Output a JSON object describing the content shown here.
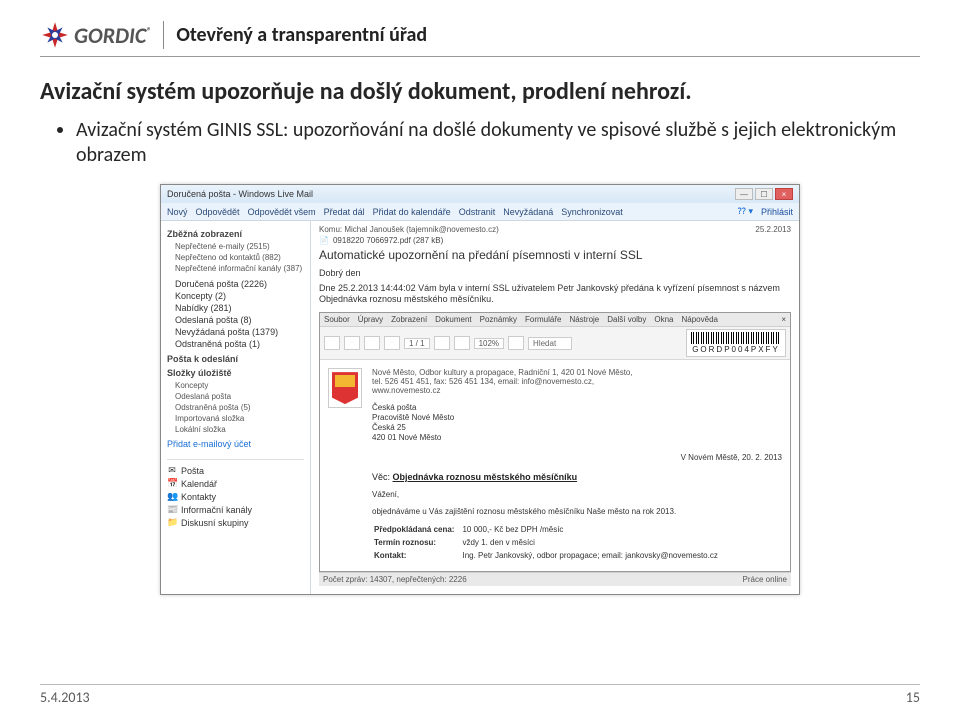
{
  "branding": {
    "name": "GORDIC",
    "reg": "®"
  },
  "presentation_title": "Otevřený a transparentní úřad",
  "headline": "Avizační systém upozorňuje na došlý dokument, prodlení nehrozí.",
  "bullet": "Avizační systém GINIS SSL: upozorňování na došlé dokumenty ve spisové službě s jejich elektronickým obrazem",
  "wlm": {
    "title": "Doručená pošta - Windows Live Mail",
    "toolbar": {
      "novy": "Nový",
      "odpovedet": "Odpovědět",
      "odpovedet_vsem": "Odpovědět všem",
      "predat": "Předat dál",
      "kalendar": "Přidat do kalendáře",
      "odstranit": "Odstranit",
      "nevyzadana": "Nevyžádaná",
      "sync": "Synchronizovat",
      "prihlasit": "Přihlásit"
    },
    "sidebar": {
      "rychle_hdr": "Zběžná zobrazení",
      "rychle": [
        "Nepřečtené e-maily  (2515)",
        "Nepřečteno od kontaktů  (882)",
        "Nepřečtené informační kanály  (387)"
      ],
      "folders": [
        "Doručená pošta  (2226)",
        "Koncepty  (2)",
        "Nabídky  (281)",
        "Odeslaná pošta  (8)",
        "Nevyžádaná pošta  (1379)",
        "Odstraněná pošta  (1)"
      ],
      "odeslani_hdr": "Pošta k odeslání",
      "uloziste_hdr": "Složky úložiště",
      "uloziste": [
        "Koncepty",
        "Odeslaná pošta",
        "Odstraněná pošta  (5)",
        "Importovaná složka",
        "Lokální složka"
      ],
      "add_link": "Přidat e-mailový účet",
      "bottom": [
        {
          "icon": "✉",
          "label": "Pošta"
        },
        {
          "icon": "📅",
          "label": "Kalendář"
        },
        {
          "icon": "👥",
          "label": "Kontakty"
        },
        {
          "icon": "📰",
          "label": "Informační kanály"
        },
        {
          "icon": "📁",
          "label": "Diskusní skupiny"
        }
      ]
    },
    "mail": {
      "from_label": "Komu:",
      "from": "Michal Janoušek (tajemnik@novemesto.cz)",
      "date": "25.2.2013",
      "attachment": "0918220 7066972.pdf (287 kB)",
      "subject": "Automatické upozornění na předání písemnosti v interní SSL",
      "greeting": "Dobrý den",
      "body_line": "Dne 25.2.2013 14:44:02 Vám byla v interní SSL uživatelem Petr Jankovský předána k vyřízení písemnost s názvem Objednávka roznosu městského měsíčníku."
    }
  },
  "inner": {
    "menu": [
      "Soubor",
      "Úpravy",
      "Zobrazení",
      "Dokument",
      "Poznámky",
      "Formuláře",
      "Nástroje",
      "Další volby",
      "Okna",
      "Nápověda"
    ],
    "zoom": "102%",
    "hledat_placeholder": "Hledat",
    "page_field": "1 / 1",
    "barcode": "GORDP004PXFY",
    "sender": "Nové Město, Odbor kultury a propagace, Radniční 1, 420 01 Nové Město,\ntel. 526 451 451, fax: 526 451 134, email: info@novemesto.cz,\nwww.novemesto.cz",
    "recipient": [
      "Česká pošta",
      "Pracoviště Nové Město",
      "Česká 25",
      "420 01 Nové Město"
    ],
    "place_date": "V Novém Městě, 20. 2. 2013",
    "vec_label": "Věc:",
    "vec": "Objednávka roznosu městského měsíčníku",
    "salutation": "Vážení,",
    "para": "objednáváme u Vás zajištění roznosu městského měsíčníku Naše město na rok 2013.",
    "rows": [
      {
        "k": "Předpokládaná cena:",
        "v": "10 000,- Kč bez DPH /měsíc"
      },
      {
        "k": "Termín roznosu:",
        "v": "vždy 1. den v měsíci"
      },
      {
        "k": "Kontakt:",
        "v": "Ing. Petr Jankovský, odbor propagace; email: jankovsky@novemesto.cz"
      }
    ],
    "status_left": "Počet zpráv: 14307, nepřečtených: 2226",
    "status_right": "Práce online"
  },
  "footer": {
    "date": "5.4.2013",
    "page": "15"
  }
}
